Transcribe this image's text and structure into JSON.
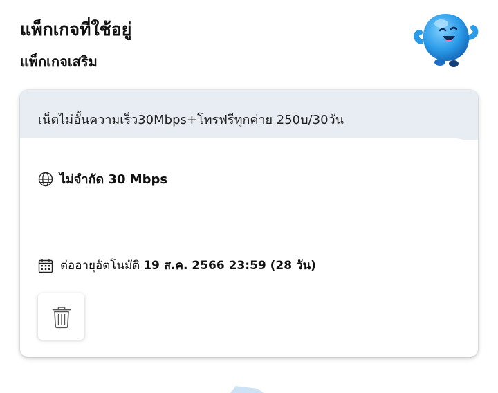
{
  "header": {
    "title": "แพ็กเกจที่ใช้อยู่",
    "subtitle": "แพ็กเกจเสริม"
  },
  "package_card": {
    "name": "เน็ตไม่อั้นความเร็ว30Mbps+โทรฟรีทุกค่าย 250บ/30วัน",
    "speed": {
      "icon": "globe-icon",
      "label": "ไม่จำกัด 30 Mbps"
    },
    "renewal": {
      "icon": "calendar-icon",
      "label": "ต่ออายุอัตโนมัติ",
      "date": "19 ส.ค. 2566 23:59 (28 วัน)"
    },
    "delete_icon": "trash-icon"
  },
  "colors": {
    "card_header_bg": "#e7edf3",
    "mascot_blue": "#2b9be8",
    "text": "#111111"
  }
}
